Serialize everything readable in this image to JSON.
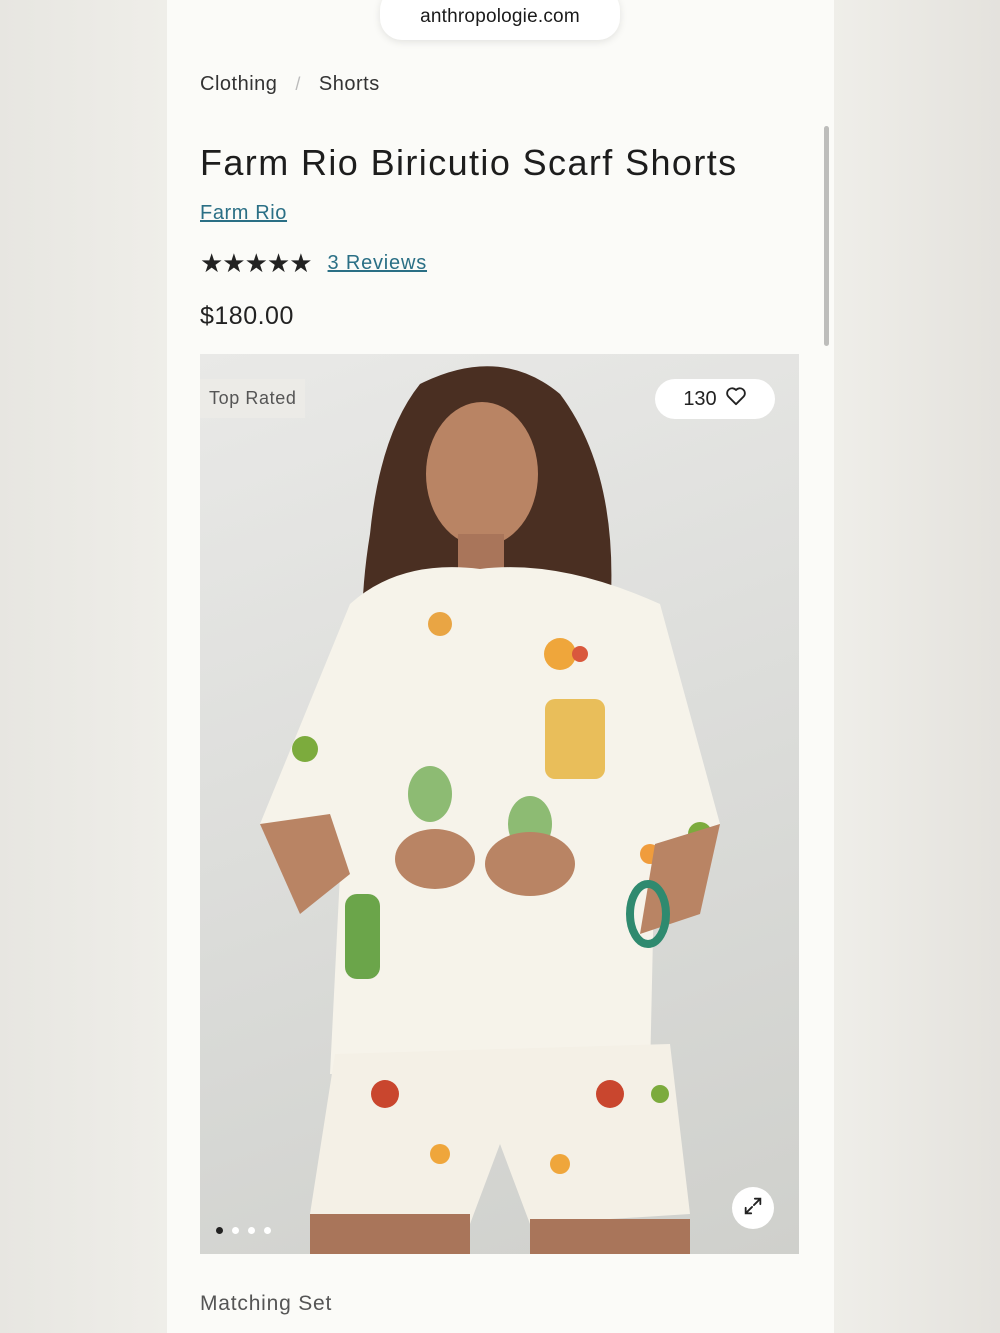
{
  "browser": {
    "url": "anthropologie.com"
  },
  "breadcrumb": {
    "items": [
      "Clothing",
      "Shorts"
    ],
    "separator": "/"
  },
  "product": {
    "title": "Farm Rio Biricutio Scarf Shorts",
    "brand": "Farm Rio",
    "rating": {
      "stars": "★★★★★",
      "value": 5,
      "max": 5
    },
    "reviews_label": "3 Reviews",
    "price": "$180.00"
  },
  "gallery": {
    "badge": "Top Rated",
    "likes": "130",
    "current_slide": 1,
    "total_slides": 4,
    "icons": {
      "like": "heart-icon",
      "expand": "expand-icon"
    }
  },
  "sections": {
    "matching_set": "Matching Set"
  },
  "colors": {
    "link": "#2a6f85",
    "text": "#1f1f1f",
    "background": "#fbfbf8"
  }
}
